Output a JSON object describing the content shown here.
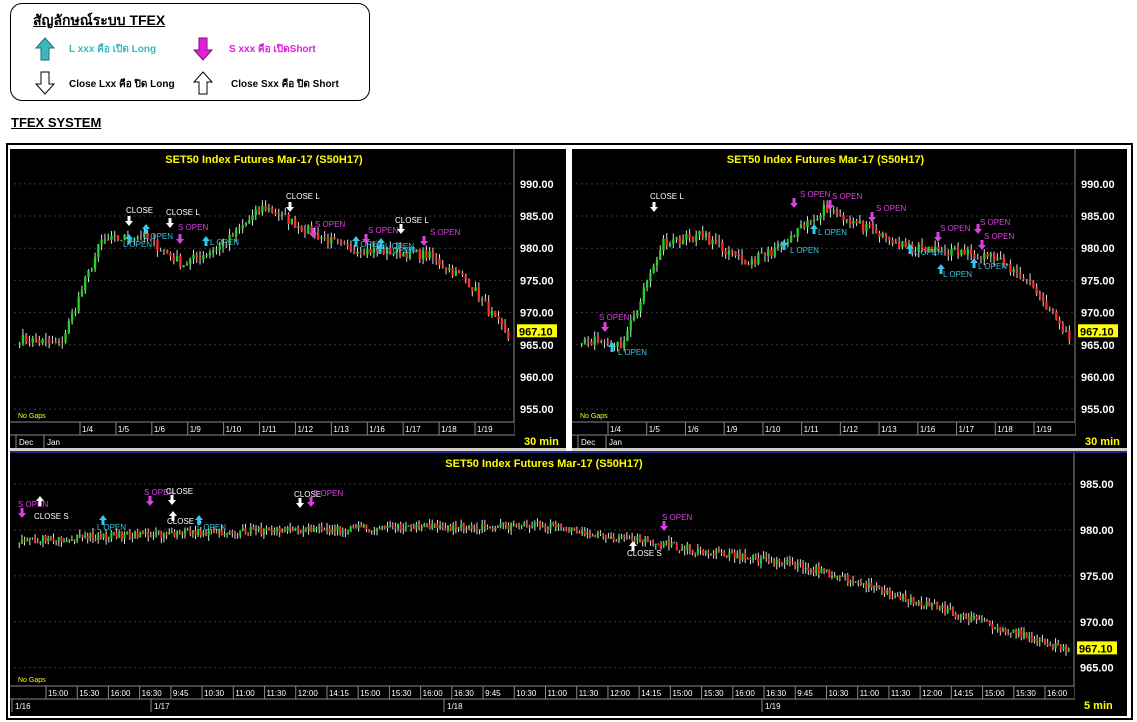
{
  "legend": {
    "title": "สัญลักษณ์ระบบ TFEX",
    "long_open": "L xxx คือ เปิด Long",
    "short_open": "S xxx คือ เปิดShort",
    "long_close": "Close Lxx คือ ปิด Long",
    "short_close": "Close Sxx คือ ปิด Short",
    "colors": {
      "long_open": "#39b8c2",
      "short_open": "#e11fd8"
    }
  },
  "system_title": "TFEX SYSTEM",
  "colors": {
    "up": "#1fd61f",
    "down": "#ff2a2a",
    "label_long": "#33c8e8",
    "label_short": "#e040e0",
    "label_close": "#ffffff",
    "title": "#ffff00",
    "price_box": "#ffff00"
  },
  "charts": [
    {
      "title": "SET50  Index  Futures  Mar-17  (S50H17)",
      "no_gaps": "No Gaps",
      "timeframe": "30  min",
      "last_price": "967.10",
      "y_ticks": [
        "990.00",
        "985.00",
        "980.00",
        "975.00",
        "970.00",
        "965.00",
        "960.00",
        "955.00"
      ],
      "x_ticks": [
        "1/4",
        "1/5",
        "1/6",
        "1/9",
        "1/10",
        "1/11",
        "1/12",
        "1/13",
        "1/16",
        "1/17",
        "1/18",
        "1/19"
      ],
      "month_ticks": [
        "Dec",
        "Jan"
      ],
      "signals": [
        {
          "text": "CLOSE",
          "side": "close"
        },
        {
          "text": "L OPEN",
          "side": "long"
        },
        {
          "text": "CLOSE L",
          "side": "close"
        },
        {
          "text": "S OPEN",
          "side": "short"
        },
        {
          "text": "L OPEN",
          "side": "long"
        },
        {
          "text": "L OPEN",
          "side": "long"
        },
        {
          "text": "CLOSE L",
          "side": "close"
        },
        {
          "text": "S OPEN",
          "side": "short"
        },
        {
          "text": "L OPEN",
          "side": "long"
        },
        {
          "text": "S OPEN",
          "side": "short"
        },
        {
          "text": "L OPEN",
          "side": "long"
        },
        {
          "text": "CLOSE L",
          "side": "close"
        },
        {
          "text": "L OPEN",
          "side": "long"
        },
        {
          "text": "S OPEN",
          "side": "short"
        }
      ]
    },
    {
      "title": "SET50  Index  Futures  Mar-17  (S50H17)",
      "no_gaps": "No Gaps",
      "timeframe": "30  min",
      "last_price": "967.10",
      "y_ticks": [
        "990.00",
        "985.00",
        "980.00",
        "975.00",
        "970.00",
        "965.00",
        "960.00",
        "955.00"
      ],
      "x_ticks": [
        "1/4",
        "1/5",
        "1/6",
        "1/9",
        "1/10",
        "1/11",
        "1/12",
        "1/13",
        "1/16",
        "1/17",
        "1/18",
        "1/19"
      ],
      "month_ticks": [
        "Dec",
        "Jan"
      ],
      "signals": [
        {
          "text": "S OPEN",
          "side": "short"
        },
        {
          "text": "L OPEN",
          "side": "long"
        },
        {
          "text": "CLOSE L",
          "side": "close"
        },
        {
          "text": "S OPEN",
          "side": "short"
        },
        {
          "text": "L OPEN",
          "side": "long"
        },
        {
          "text": "S OPEN",
          "side": "short"
        },
        {
          "text": "L OPEN",
          "side": "long"
        },
        {
          "text": "S OPEN",
          "side": "short"
        },
        {
          "text": "L OPEN",
          "side": "long"
        },
        {
          "text": "S OPEN",
          "side": "short"
        },
        {
          "text": "L OPEN",
          "side": "long"
        },
        {
          "text": "S OPEN",
          "side": "short"
        },
        {
          "text": "S OPEN",
          "side": "short"
        },
        {
          "text": "L OPEN",
          "side": "long"
        }
      ]
    },
    {
      "title": "SET50  Index  Futures  Mar-17  (S50H17)",
      "no_gaps": "No Gaps",
      "timeframe": "5  min",
      "last_price": "967.10",
      "y_ticks": [
        "985.00",
        "980.00",
        "975.00",
        "970.00",
        "965.00"
      ],
      "x_ticks": [
        "15:00",
        "15:30",
        "16:00",
        "16:30",
        "9:45",
        "10:30",
        "11:00",
        "11:30",
        "12:00",
        "14:15",
        "15:00",
        "15:30",
        "16:00",
        "16:30",
        "9:45",
        "10:30",
        "11:00",
        "11:30",
        "12:00",
        "14:15",
        "15:00",
        "15:30",
        "16:00",
        "16:30",
        "9:45",
        "10:30",
        "11:00",
        "11:30",
        "12:00",
        "14:15",
        "15:00",
        "15:30",
        "16:00"
      ],
      "date_ticks": [
        "1/16",
        "1/17",
        "1/18",
        "1/19"
      ],
      "signals": [
        {
          "text": "S OPEN",
          "side": "short"
        },
        {
          "text": "CLOSE S",
          "side": "close"
        },
        {
          "text": "L OPEN",
          "side": "long"
        },
        {
          "text": "S OPEN",
          "side": "short"
        },
        {
          "text": "CLOSE",
          "side": "close"
        },
        {
          "text": "CLOSE S",
          "side": "close"
        },
        {
          "text": "L OPEN",
          "side": "long"
        },
        {
          "text": "CLOSE",
          "side": "close"
        },
        {
          "text": "S OPEN",
          "side": "short"
        },
        {
          "text": "S OPEN",
          "side": "short"
        },
        {
          "text": "CLOSE S",
          "side": "close"
        }
      ]
    }
  ],
  "chart_data": [
    {
      "type": "candlestick",
      "title": "SET50  Index  Futures  Mar-17  (S50H17)",
      "timeframe": "30  min",
      "ylim": [
        953,
        992
      ],
      "x": [
        "1/4",
        "1/5",
        "1/6",
        "1/9",
        "1/10",
        "1/11",
        "1/12",
        "1/13",
        "1/16",
        "1/17",
        "1/18",
        "1/19"
      ],
      "close": [
        965.0,
        981.0,
        982.0,
        977.5,
        980.5,
        986.5,
        983.0,
        980.0,
        979.5,
        979.0,
        975.0,
        966.0
      ],
      "last": 967.1
    },
    {
      "type": "candlestick",
      "title": "SET50  Index  Futures  Mar-17  (S50H17)",
      "timeframe": "30  min",
      "ylim": [
        953,
        992
      ],
      "x": [
        "1/4",
        "1/5",
        "1/6",
        "1/9",
        "1/10",
        "1/11",
        "1/12",
        "1/13",
        "1/16",
        "1/17",
        "1/18",
        "1/19"
      ],
      "close": [
        965.0,
        981.0,
        982.0,
        977.5,
        980.5,
        986.5,
        983.0,
        980.0,
        979.5,
        979.0,
        975.0,
        966.0
      ],
      "last": 967.1
    },
    {
      "type": "candlestick",
      "title": "SET50  Index  Futures  Mar-17  (S50H17)",
      "timeframe": "5  min",
      "ylim": [
        963,
        986
      ],
      "x": [
        "1/16",
        "1/17",
        "1/18",
        "1/19"
      ],
      "close": [
        980.0,
        980.5,
        976.0,
        967.0
      ],
      "last": 967.1
    }
  ]
}
